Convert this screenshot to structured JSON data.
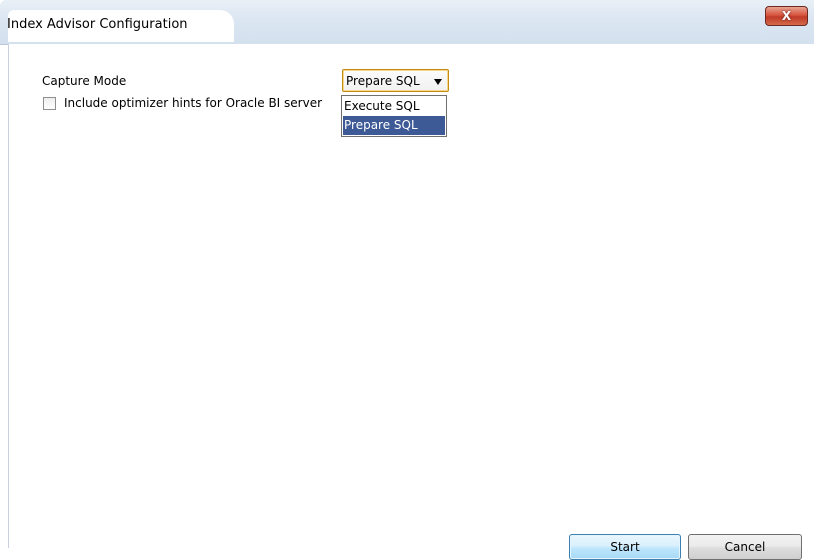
{
  "window": {
    "title": "Index Advisor Configuration",
    "close_glyph": "X"
  },
  "form": {
    "capture_mode_label": "Capture Mode",
    "capture_mode_value": "Prepare SQL",
    "capture_mode_options": [
      "Execute SQL",
      "Prepare SQL"
    ],
    "capture_mode_highlighted": "Prepare SQL",
    "include_hints_label": "Include optimizer hints for Oracle BI server",
    "include_hints_checked": false
  },
  "buttons": {
    "start": "Start",
    "cancel": "Cancel"
  },
  "colors": {
    "selection": "#3d5a96",
    "close_button": "#c03a28",
    "combo_focus_border": "#c48b12"
  }
}
